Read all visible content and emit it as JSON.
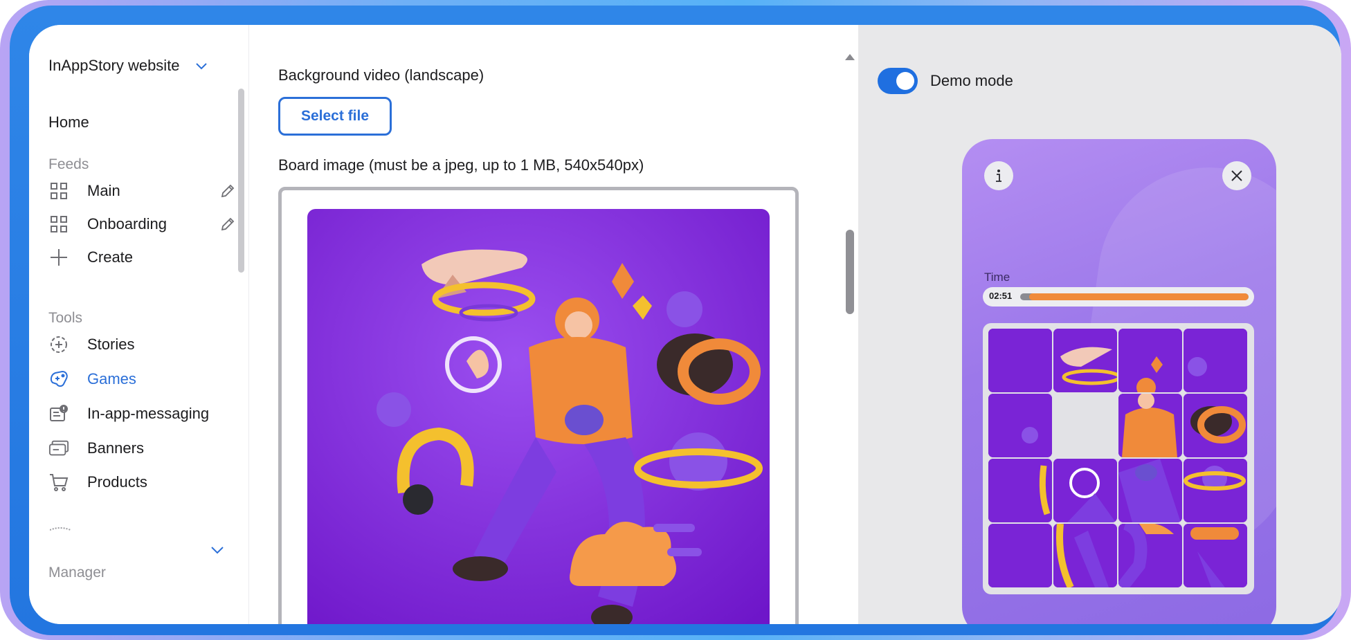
{
  "sidebar": {
    "workspace": "InAppStory website",
    "home": "Home",
    "feeds_section": "Feeds",
    "feeds": [
      {
        "label": "Main"
      },
      {
        "label": "Onboarding"
      }
    ],
    "create": "Create",
    "tools_section": "Tools",
    "tools": [
      {
        "label": "Stories",
        "icon": "stories-icon"
      },
      {
        "label": "Games",
        "icon": "gamepad-icon",
        "active": true
      },
      {
        "label": "In-app-messaging",
        "icon": "message-icon"
      },
      {
        "label": "Banners",
        "icon": "banner-icon"
      },
      {
        "label": "Products",
        "icon": "cart-icon"
      }
    ],
    "manager_section": "Manager"
  },
  "form": {
    "bg_video_label": "Background video (landscape)",
    "select_file": "Select file",
    "board_image_label": "Board image (must be a jpeg, up to 1 MB, 540x540px)"
  },
  "preview": {
    "demo_mode_label": "Demo mode",
    "demo_mode_on": true,
    "time_label": "Time",
    "time_value": "02:51",
    "time_remaining_fraction": 0.96,
    "empty_tile_index": 5
  },
  "colors": {
    "accent": "#2b6fd8",
    "puzzle_purple": "#7a24d6",
    "timer_orange": "#f08a3a"
  }
}
